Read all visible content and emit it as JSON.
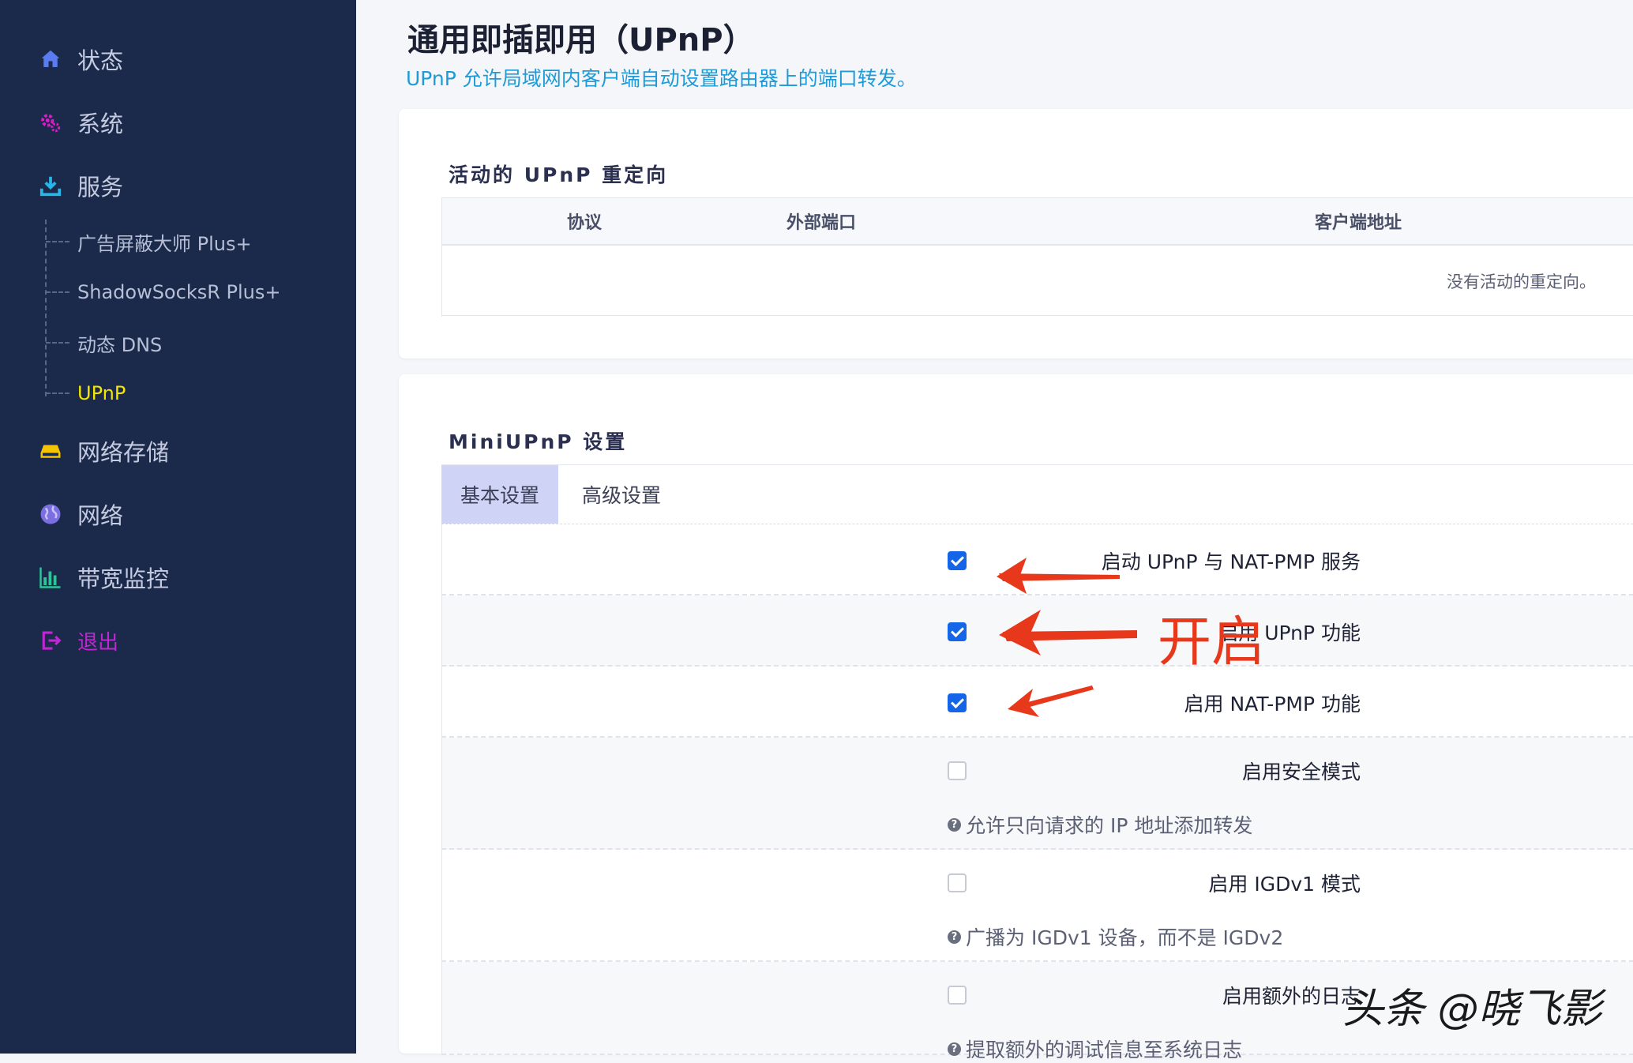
{
  "sidebar": {
    "items": [
      {
        "label": "状态",
        "icon": "home-icon"
      },
      {
        "label": "系统",
        "icon": "gears-icon"
      },
      {
        "label": "服务",
        "icon": "download-icon"
      },
      {
        "label": "网络存储",
        "icon": "drive-icon"
      },
      {
        "label": "网络",
        "icon": "globe-icon"
      },
      {
        "label": "带宽监控",
        "icon": "bar-chart-icon"
      },
      {
        "label": "退出",
        "icon": "logout-icon"
      }
    ],
    "service_children": [
      "广告屏蔽大师 Plus+",
      "ShadowSocksR Plus+",
      "动态 DNS",
      "UPnP"
    ],
    "active_child": "UPnP"
  },
  "page": {
    "title": "通用即插即用（UPnP）",
    "description": "UPnP 允许局域网内客户端自动设置路由器上的端口转发。"
  },
  "redirects": {
    "title": "活动的 UPnP 重定向",
    "columns": [
      "协议",
      "外部端口",
      "客户端地址"
    ],
    "empty_message": "没有活动的重定向。"
  },
  "settings": {
    "title": "MiniUPnP 设置",
    "tabs": [
      "基本设置",
      "高级设置"
    ],
    "active_tab": "基本设置",
    "options": [
      {
        "label": "启动 UPnP 与 NAT-PMP 服务",
        "checked": true,
        "help": ""
      },
      {
        "label": "启用 UPnP 功能",
        "checked": true,
        "help": ""
      },
      {
        "label": "启用 NAT-PMP 功能",
        "checked": true,
        "help": ""
      },
      {
        "label": "启用安全模式",
        "checked": false,
        "help": "允许只向请求的 IP 地址添加转发"
      },
      {
        "label": "启用 IGDv1 模式",
        "checked": false,
        "help": "广播为 IGDv1 设备，而不是 IGDv2"
      },
      {
        "label": "启用额外的日志",
        "checked": false,
        "help": "提取额外的调试信息至系统日志"
      }
    ]
  },
  "annotation": {
    "text": "开启",
    "color": "#e8381c"
  },
  "watermark": "头条 @晓飞影",
  "colors": {
    "sidebar_bg": "#1b2a4a",
    "accent_link": "#1e9bd7",
    "active_child": "#f5e600",
    "logout": "#c026d3",
    "checkbox_on": "#1565e8"
  }
}
